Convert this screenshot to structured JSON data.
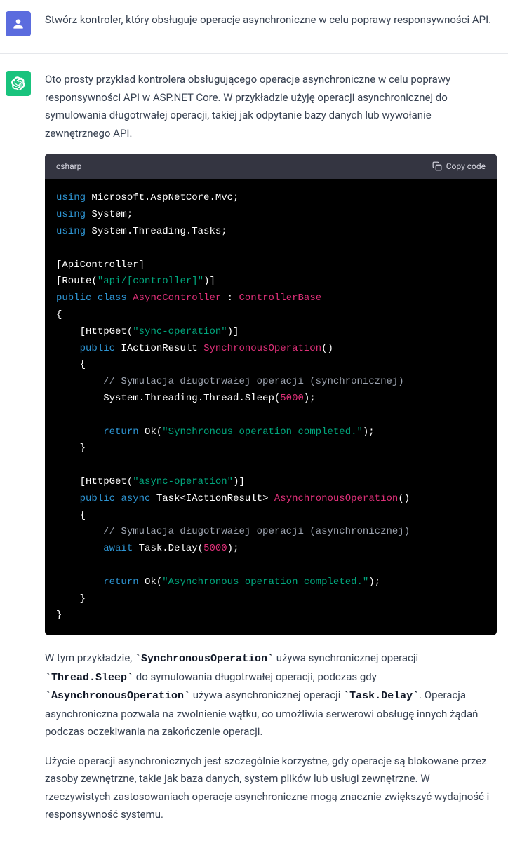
{
  "user": {
    "prompt": "Stwórz kontroler, który obsługuje operacje asynchroniczne w celu poprawy responsywności API."
  },
  "assistant": {
    "intro": "Oto prosty przykład kontrolera obsługującego operacje asynchroniczne w celu poprawy responsywności API w ASP.NET Core. W przykładzie użyję operacji asynchronicznej do symulowania długotrwałej operacji, takiej jak odpytanie bazy danych lub wywołanie zewnętrznego API.",
    "code": {
      "language": "csharp",
      "copy_label": "Copy code",
      "lines": [
        {
          "t": "using",
          "p": [
            {
              "c": "kw",
              "v": "using"
            },
            {
              "c": "",
              "v": " Microsoft.AspNetCore.Mvc;"
            }
          ]
        },
        {
          "t": "using",
          "p": [
            {
              "c": "kw",
              "v": "using"
            },
            {
              "c": "",
              "v": " System;"
            }
          ]
        },
        {
          "t": "using",
          "p": [
            {
              "c": "kw",
              "v": "using"
            },
            {
              "c": "",
              "v": " System.Threading.Tasks;"
            }
          ]
        },
        {
          "t": "blank",
          "p": [
            {
              "c": "",
              "v": ""
            }
          ]
        },
        {
          "t": "attr",
          "p": [
            {
              "c": "",
              "v": "["
            },
            {
              "c": "attr",
              "v": "ApiController"
            },
            {
              "c": "",
              "v": "]"
            }
          ]
        },
        {
          "t": "attr",
          "p": [
            {
              "c": "",
              "v": "["
            },
            {
              "c": "attr",
              "v": "Route"
            },
            {
              "c": "",
              "v": "("
            },
            {
              "c": "str",
              "v": "\"api/[controller]\""
            },
            {
              "c": "",
              "v": ")]"
            }
          ]
        },
        {
          "t": "class",
          "p": [
            {
              "c": "kw",
              "v": "public"
            },
            {
              "c": "",
              "v": " "
            },
            {
              "c": "kw",
              "v": "class"
            },
            {
              "c": "",
              "v": " "
            },
            {
              "c": "type",
              "v": "AsyncController"
            },
            {
              "c": "",
              "v": " : "
            },
            {
              "c": "type",
              "v": "ControllerBase"
            }
          ]
        },
        {
          "t": "brace",
          "p": [
            {
              "c": "",
              "v": "{"
            }
          ]
        },
        {
          "t": "attr",
          "p": [
            {
              "c": "",
              "v": "    ["
            },
            {
              "c": "attr",
              "v": "HttpGet"
            },
            {
              "c": "",
              "v": "("
            },
            {
              "c": "str",
              "v": "\"sync-operation\""
            },
            {
              "c": "",
              "v": ")]"
            }
          ]
        },
        {
          "t": "method",
          "p": [
            {
              "c": "",
              "v": "    "
            },
            {
              "c": "kw",
              "v": "public"
            },
            {
              "c": "",
              "v": " IActionResult "
            },
            {
              "c": "type",
              "v": "SynchronousOperation"
            },
            {
              "c": "",
              "v": "()"
            }
          ]
        },
        {
          "t": "brace",
          "p": [
            {
              "c": "",
              "v": "    {"
            }
          ]
        },
        {
          "t": "comment",
          "p": [
            {
              "c": "",
              "v": "        "
            },
            {
              "c": "com",
              "v": "// Symulacja długotrwałej operacji (synchronicznej)"
            }
          ]
        },
        {
          "t": "stmt",
          "p": [
            {
              "c": "",
              "v": "        System.Threading.Thread.Sleep("
            },
            {
              "c": "num",
              "v": "5000"
            },
            {
              "c": "",
              "v": ");"
            }
          ]
        },
        {
          "t": "blank",
          "p": [
            {
              "c": "",
              "v": ""
            }
          ]
        },
        {
          "t": "return",
          "p": [
            {
              "c": "",
              "v": "        "
            },
            {
              "c": "kw",
              "v": "return"
            },
            {
              "c": "",
              "v": " Ok("
            },
            {
              "c": "str",
              "v": "\"Synchronous operation completed.\""
            },
            {
              "c": "",
              "v": ");"
            }
          ]
        },
        {
          "t": "brace",
          "p": [
            {
              "c": "",
              "v": "    }"
            }
          ]
        },
        {
          "t": "blank",
          "p": [
            {
              "c": "",
              "v": ""
            }
          ]
        },
        {
          "t": "attr",
          "p": [
            {
              "c": "",
              "v": "    ["
            },
            {
              "c": "attr",
              "v": "HttpGet"
            },
            {
              "c": "",
              "v": "("
            },
            {
              "c": "str",
              "v": "\"async-operation\""
            },
            {
              "c": "",
              "v": ")]"
            }
          ]
        },
        {
          "t": "method",
          "p": [
            {
              "c": "",
              "v": "    "
            },
            {
              "c": "kw",
              "v": "public"
            },
            {
              "c": "",
              "v": " "
            },
            {
              "c": "kw",
              "v": "async"
            },
            {
              "c": "",
              "v": " Task<IActionResult> "
            },
            {
              "c": "type",
              "v": "AsynchronousOperation"
            },
            {
              "c": "",
              "v": "()"
            }
          ]
        },
        {
          "t": "brace",
          "p": [
            {
              "c": "",
              "v": "    {"
            }
          ]
        },
        {
          "t": "comment",
          "p": [
            {
              "c": "",
              "v": "        "
            },
            {
              "c": "com",
              "v": "// Symulacja długotrwałej operacji (asynchronicznej)"
            }
          ]
        },
        {
          "t": "stmt",
          "p": [
            {
              "c": "",
              "v": "        "
            },
            {
              "c": "kw",
              "v": "await"
            },
            {
              "c": "",
              "v": " Task.Delay("
            },
            {
              "c": "num",
              "v": "5000"
            },
            {
              "c": "",
              "v": ");"
            }
          ]
        },
        {
          "t": "blank",
          "p": [
            {
              "c": "",
              "v": ""
            }
          ]
        },
        {
          "t": "return",
          "p": [
            {
              "c": "",
              "v": "        "
            },
            {
              "c": "kw",
              "v": "return"
            },
            {
              "c": "",
              "v": " Ok("
            },
            {
              "c": "str",
              "v": "\"Asynchronous operation completed.\""
            },
            {
              "c": "",
              "v": ");"
            }
          ]
        },
        {
          "t": "brace",
          "p": [
            {
              "c": "",
              "v": "    }"
            }
          ]
        },
        {
          "t": "brace",
          "p": [
            {
              "c": "",
              "v": "}"
            }
          ]
        }
      ]
    },
    "explain1_part1": "W tym przykładzie, ",
    "explain1_code1": "`SynchronousOperation`",
    "explain1_part2": " używa synchronicznej operacji ",
    "explain1_code2": "`Thread.Sleep`",
    "explain1_part3": " do symulowania długotrwałej operacji, podczas gdy ",
    "explain1_code3": "`AsynchronousOperation`",
    "explain1_part4": " używa asynchronicznej operacji ",
    "explain1_code4": "`Task.Delay`",
    "explain1_part5": ". Operacja asynchroniczna pozwala na zwolnienie wątku, co umożliwia serwerowi obsługę innych żądań podczas oczekiwania na zakończenie operacji.",
    "explain2": "Użycie operacji asynchronicznych jest szczególnie korzystne, gdy operacje są blokowane przez zasoby zewnętrzne, takie jak baza danych, system plików lub usługi zewnętrzne. W rzeczywistych zastosowaniach operacje asynchroniczne mogą znacznie zwiększyć wydajność i responsywność systemu."
  }
}
